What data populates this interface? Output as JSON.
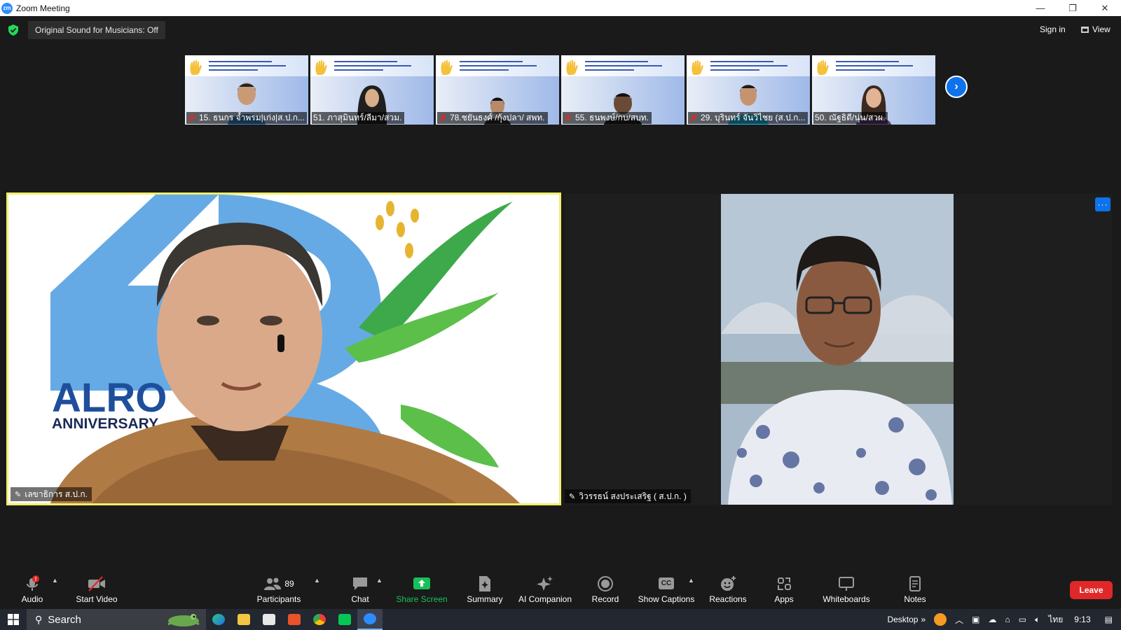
{
  "window": {
    "title": "Zoom Meeting",
    "min": "—",
    "restore": "❐",
    "close": "✕"
  },
  "topbar": {
    "original_sound": "Original Sound for Musicians: Off",
    "sign_in": "Sign in",
    "view": "View"
  },
  "thumbnails": [
    {
      "name": "15. ธนกร จ้ำพรม|เก่ง|ส.ป.ก...",
      "muted": true,
      "hand_raised": true
    },
    {
      "name": "51. ภาสุมินทร์/ลีมา/สวม.",
      "muted": false,
      "hand_raised": true
    },
    {
      "name": "78.ชยันธงศ์ /กุ้งปลา/ สพท.",
      "muted": true,
      "hand_raised": true
    },
    {
      "name": "55. ธนพงษ์/กบ/สบท.",
      "muted": true,
      "hand_raised": true
    },
    {
      "name": "29. บุรินทร์ จันวิไชย (ส.ป.ก...",
      "muted": true,
      "hand_raised": true
    },
    {
      "name": "50. ณัฐธิดี/นุ่น/สวผ.",
      "muted": false,
      "hand_raised": true
    }
  ],
  "main_videos": {
    "left": {
      "name": "เลขาธิการ ส.ป.ก.",
      "logo_text": "ALRO",
      "logo_sub": "ANNIVERSARY"
    },
    "right": {
      "name": "วิวรรธน์ สงประเสริฐ ( ส.ป.ก. )",
      "more": "···"
    }
  },
  "toolbar": {
    "audio": "Audio",
    "start_video": "Start Video",
    "participants": "Participants",
    "participants_count": "89",
    "chat": "Chat",
    "share_screen": "Share Screen",
    "summary": "Summary",
    "ai_companion": "AI Companion",
    "record": "Record",
    "show_captions": "Show Captions",
    "captions_icon": "CC",
    "reactions": "Reactions",
    "apps": "Apps",
    "whiteboards": "Whiteboards",
    "notes": "Notes",
    "leave": "Leave"
  },
  "taskbar": {
    "search": "Search",
    "desktop": "Desktop",
    "chevrons": "»",
    "language": "ไทย",
    "time": "9:13"
  },
  "colors": {
    "accent": "#0e72ed",
    "share_green": "#17c05b",
    "leave_red": "#e02828",
    "active_speaker_border": "#f1ee6c"
  }
}
